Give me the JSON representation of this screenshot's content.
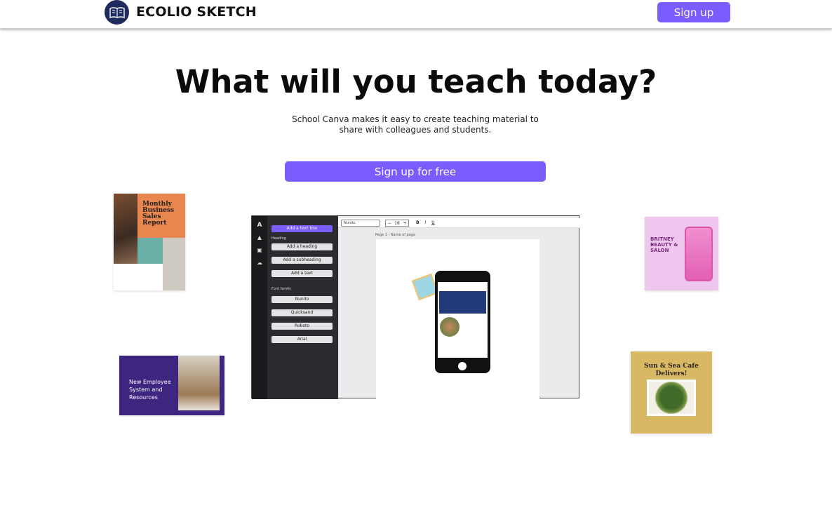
{
  "header": {
    "brand": "ECOLIO SKETCH",
    "signup_label": "Sign up",
    "logo_icon": "book-icon"
  },
  "hero": {
    "title": "What will you teach today?",
    "subtitle": "School Canva makes it easy to create teaching material to share with colleagues and students.",
    "cta_label": "Sign up for free"
  },
  "cards": {
    "sales": {
      "title": "Monthly Business Sales Report"
    },
    "employee": {
      "title": "New Employee System and Resources"
    },
    "beauty": {
      "title": "BRITNEY BEAUTY & SALON"
    },
    "cafe": {
      "title": "Sun & Sea Cafe Delivers!"
    }
  },
  "editor": {
    "rail": [
      "Text",
      "Shapes",
      "Photos",
      "Uploads"
    ],
    "add_textbox": "Add a text box",
    "heading_label": "Heading",
    "add_heading": "Add a heading",
    "add_subheading": "Add a subheading",
    "add_text": "Add a text",
    "font_family_label": "Font family",
    "fonts": [
      "Nunito",
      "Quicksand",
      "Roboto",
      "Arial"
    ],
    "toolbar_font": "Nunito",
    "font_size": "16",
    "page_label": "Page 1 - Name of page"
  },
  "colors": {
    "accent": "#7a5cff",
    "logo_bg": "#1f2b5c"
  }
}
